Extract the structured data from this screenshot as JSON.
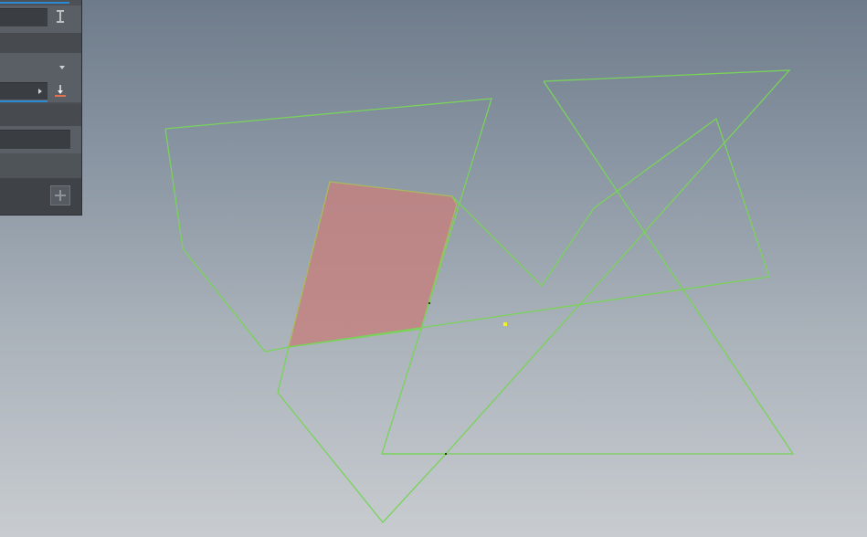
{
  "panel": {
    "height_field": {
      "value": "",
      "icon": "height-icon"
    },
    "mode_dropdown": {
      "selected": "",
      "icon": "chevron-down-icon"
    },
    "base_field": {
      "value": "",
      "icon": "drop-to-base-icon"
    },
    "name_field": {
      "value": ""
    },
    "add_button": {
      "icon": "plus-icon"
    }
  },
  "viewport": {
    "shapes": [
      {
        "name": "polygon-outline",
        "selected": false
      },
      {
        "name": "polygon-outline",
        "selected": false
      },
      {
        "name": "triangle-outline",
        "selected": false
      },
      {
        "name": "polygon-outline",
        "selected": false
      },
      {
        "name": "selected-face",
        "selected": true
      }
    ],
    "colors": {
      "outline": "#79d35a",
      "selected_fill": "#c4807f",
      "selected_outline": "#a9b95e",
      "pivot": "#f2f21a"
    }
  }
}
